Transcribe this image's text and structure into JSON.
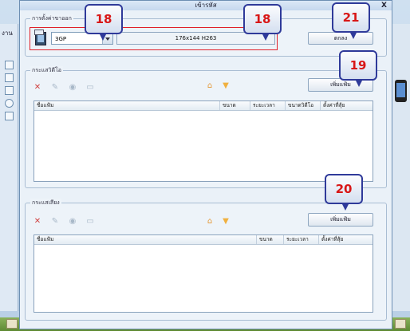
{
  "dialog": {
    "title": "เข้ารหัส",
    "close_glyph": "X"
  },
  "background": {
    "left_label": "งาน"
  },
  "output_group": {
    "label": "การตั้งค่าขาออก",
    "format_value": "3GP",
    "resolution_value": "176x144 H263",
    "ok_label": "ตกลง"
  },
  "video_group": {
    "label": "กระแสวิดีโอ",
    "add_file_label": "เพิ่มแฟ้ม",
    "columns": [
      "ชื่อแฟ้ม",
      "ขนาด",
      "ระยะเวลา",
      "ขนาดวิดีโอ",
      "ตั้งค่าที่สุ้ย"
    ]
  },
  "audio_group": {
    "label": "กระแสเสียง",
    "add_file_label": "เพิ่มแฟ้ม",
    "columns": [
      "ชื่อแฟ้ม",
      "ขนาด",
      "ระยะเวลา",
      "ตั้งค่าที่สุ้ย"
    ]
  },
  "callouts": {
    "c1": "18",
    "c2": "18",
    "c3": "21",
    "c4": "19",
    "c5": "20"
  },
  "icons": {
    "delete": "x-icon",
    "clear": "clear-icon",
    "settings": "settings-icon",
    "info": "info-icon",
    "move_up": "home-arrow-icon",
    "move_down": "down-arrow-icon"
  },
  "colors": {
    "callout_border": "#2f3a9a",
    "callout_text": "#d81616",
    "highlight": "#e0202a"
  }
}
